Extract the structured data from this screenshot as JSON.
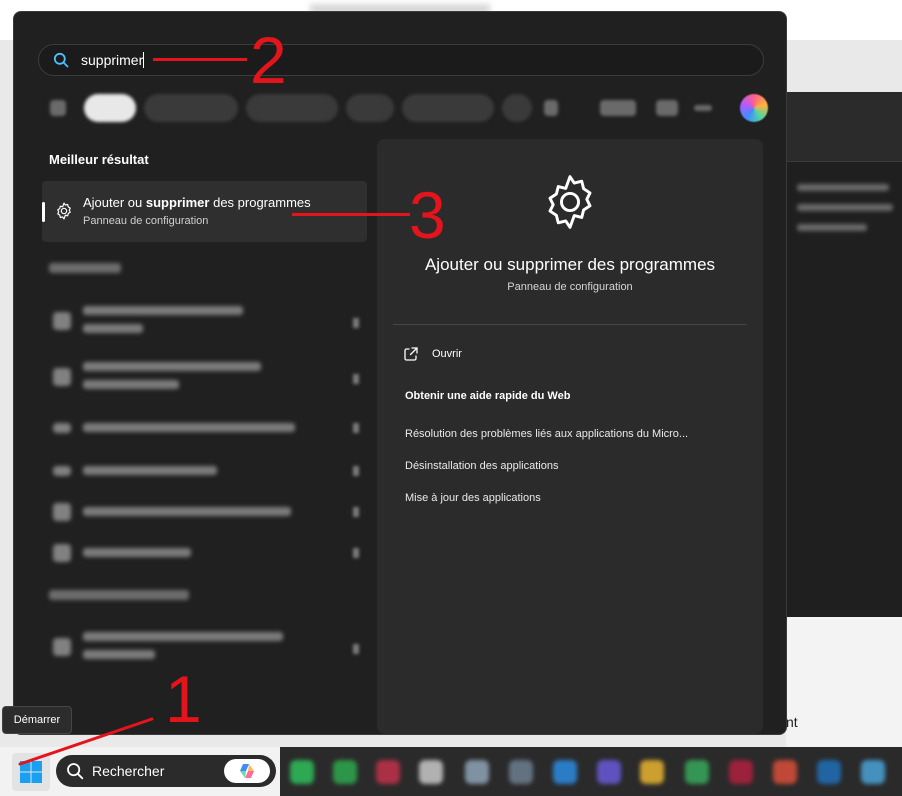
{
  "search": {
    "query": "supprimer"
  },
  "best_match": {
    "heading": "Meilleur résultat",
    "title_before": "Ajouter ou",
    "title_bold": "supprimer",
    "title_after": "des programmes",
    "subtitle": "Panneau de configuration"
  },
  "detail": {
    "title": "Ajouter ou supprimer des programmes",
    "subtitle": "Panneau de configuration",
    "open_label": "Ouvrir",
    "web_heading": "Obtenir une aide rapide du Web",
    "web_links": [
      "Résolution des problèmes liés aux applications du Micro...",
      "Désinstallation des applications",
      "Mise à jour des applications"
    ]
  },
  "tooltip": {
    "label": "Démarrer"
  },
  "taskbar": {
    "search_label": "Rechercher"
  },
  "background": {
    "partial_text": "nt"
  },
  "annotations": {
    "one": "1",
    "two": "2",
    "three": "3"
  },
  "colors": {
    "accent": "#4cc2ff",
    "annotation": "#e4141c"
  }
}
